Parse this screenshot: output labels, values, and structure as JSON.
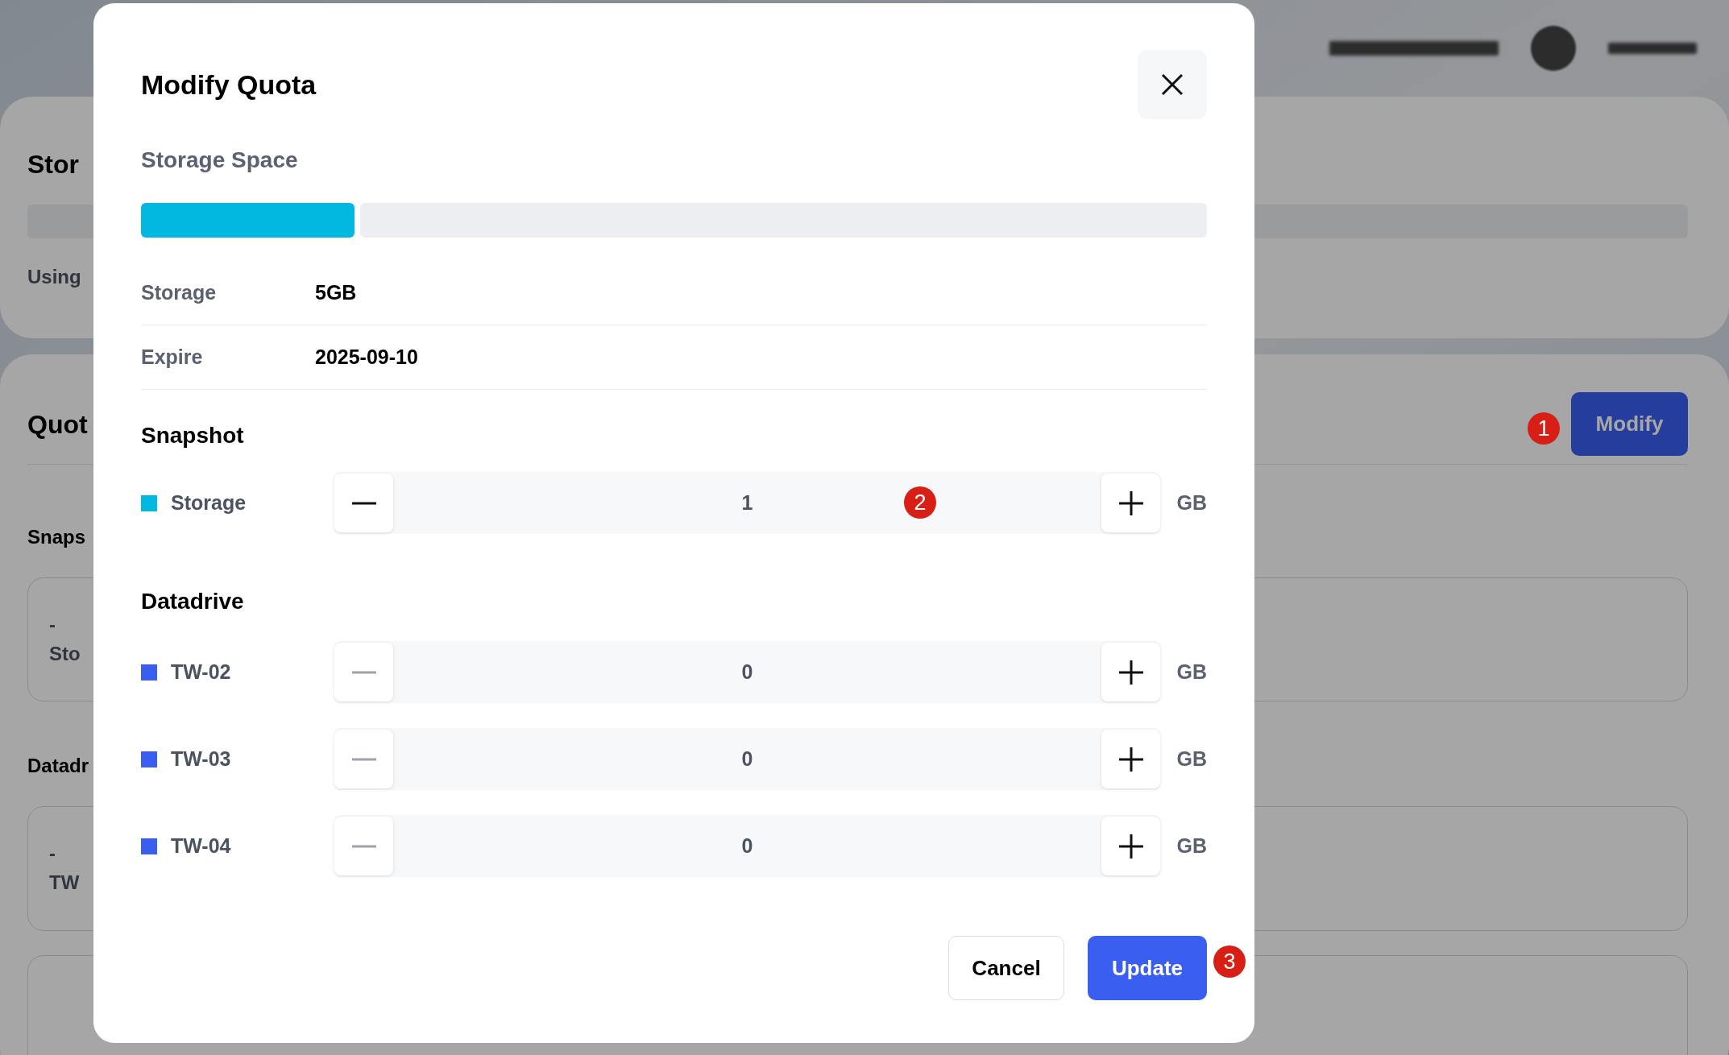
{
  "background": {
    "storage_card": {
      "title": "Stor",
      "label": "Using"
    },
    "quota_card": {
      "title": "Quot",
      "button": "Modify",
      "snapshot_heading": "Snaps",
      "snapshot_card": {
        "value": "-",
        "label": "Sto"
      },
      "datadrive_heading": "Datadr",
      "datadrive_card": {
        "value": "-",
        "label": "TW"
      }
    }
  },
  "dialog": {
    "title": "Modify Quota",
    "section_title": "Storage Space",
    "usage": {
      "level": 0.2
    },
    "details": [
      {
        "label": "Storage",
        "value": "5GB"
      },
      {
        "label": "Expire",
        "value": "2025-09-10"
      }
    ],
    "groups": [
      {
        "title": "Snapshot",
        "rows": [
          {
            "name": "Storage",
            "color": "#00b8e0",
            "value": "1",
            "unit": "GB",
            "minus_disabled": false
          }
        ]
      },
      {
        "title": "Datadrive",
        "rows": [
          {
            "name": "TW-02",
            "color": "#3a5ff0",
            "value": "0",
            "unit": "GB",
            "minus_disabled": true
          },
          {
            "name": "TW-03",
            "color": "#3a5ff0",
            "value": "0",
            "unit": "GB",
            "minus_disabled": true
          },
          {
            "name": "TW-04",
            "color": "#3a5ff0",
            "value": "0",
            "unit": "GB",
            "minus_disabled": true
          }
        ]
      }
    ],
    "buttons": [
      {
        "label": "Cancel",
        "kind": "secondary"
      },
      {
        "label": "Update",
        "kind": "primary"
      }
    ]
  },
  "annotations": [
    {
      "label": "1"
    },
    {
      "label": "2"
    },
    {
      "label": "3"
    }
  ]
}
